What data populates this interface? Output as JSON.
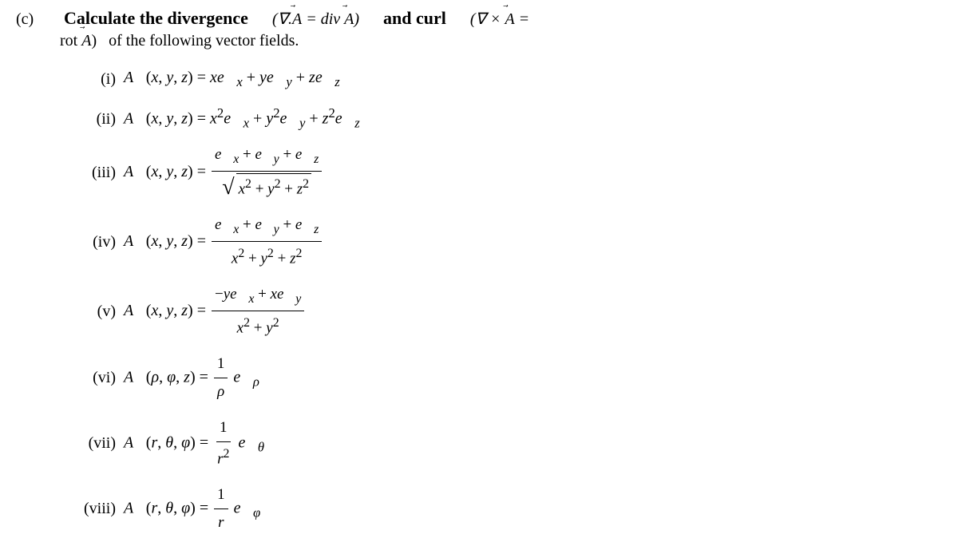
{
  "header": {
    "part_label": "(c)",
    "title": "Calculate the divergence",
    "div_notation": "(∇.A⃗ = div A⃗)",
    "and_curl": "and curl",
    "curl_notation": "(∇ × A⃗ =",
    "second_line": "rot A⃗)  of the following vector fields."
  },
  "problems": [
    {
      "label": "(i)",
      "equation": "A⃗(x, y, z) = xe⃗ₓ + ye⃗ᵧ + ze⃗_z"
    },
    {
      "label": "(ii)",
      "equation": "A⃗(x, y, z) = x²e⃗ₓ + y²e⃗ᵧ + z²e⃗_z"
    },
    {
      "label": "(iii)",
      "equation_type": "fraction",
      "numerator": "e⃗ₓ + e⃗ᵧ + e⃗_z",
      "denominator_sqrt": "x² + y² + z²"
    },
    {
      "label": "(iv)",
      "equation_type": "fraction",
      "numerator": "e⃗ₓ + e⃗ᵧ + e⃗_z",
      "denominator": "x² + y² + z²"
    },
    {
      "label": "(v)",
      "equation_type": "fraction",
      "numerator": "−ye⃗ₓ + xe⃗ᵧ",
      "denominator": "x² + y²"
    },
    {
      "label": "(vi)",
      "equation_type": "fraction_simple",
      "prefix": "A⃗(ρ, φ, z) =",
      "numerator": "1",
      "denominator": "ρ",
      "suffix": "e⃗_ρ"
    },
    {
      "label": "(vii)",
      "equation_type": "fraction_simple",
      "prefix": "A⃗(r, θ, φ) =",
      "numerator": "1",
      "denominator": "r²",
      "suffix": "e⃗_θ"
    },
    {
      "label": "(viii)",
      "equation_type": "fraction_simple",
      "prefix": "A⃗(r, θ, φ) =",
      "numerator": "1",
      "denominator": "r",
      "suffix": "e⃗_φ"
    }
  ]
}
